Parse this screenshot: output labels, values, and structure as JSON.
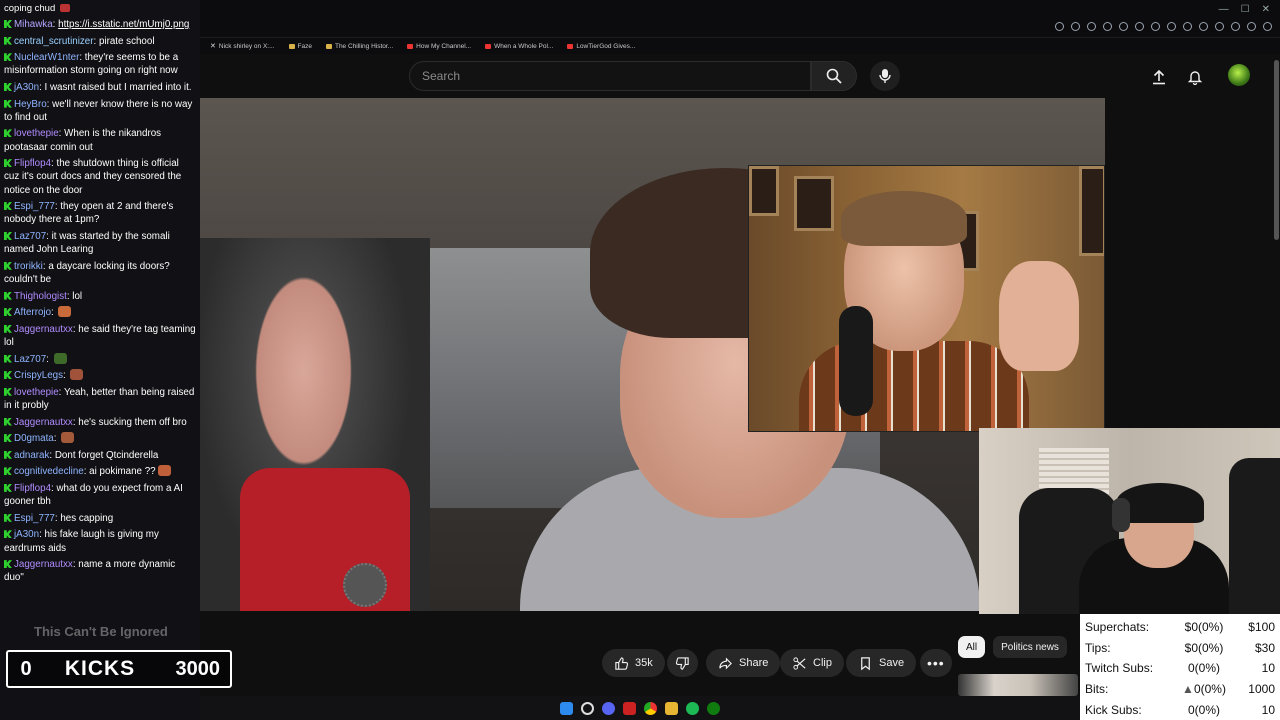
{
  "browser": {
    "bookmarks": [
      "Nick shirley on X:...",
      "Faze",
      "The Chilling Histor...",
      "How My Channel...",
      "When a Whole Pol...",
      "LowTierGod Gives..."
    ]
  },
  "youtube": {
    "search_placeholder": "Search",
    "actions": {
      "likes": "35k",
      "share": "Share",
      "clip": "Clip",
      "save": "Save"
    },
    "chips": [
      "All",
      "Politics news"
    ]
  },
  "chat": {
    "header_text": "coping chud",
    "messages": [
      {
        "user": "Mihawka",
        "text": "https://i.sstatic.net/mUmj0.png",
        "link": true,
        "color": "#b3a6ff"
      },
      {
        "user": "central_scrutinizer",
        "text": "pirate school",
        "color": "#9ad0ff"
      },
      {
        "user": "NuclearW1nter",
        "text": "they're seems to be a misinformation storm going on right now",
        "color": "#8fb4ff"
      },
      {
        "user": "jA30n",
        "text": "I wasnt raised but I married into it.",
        "color": "#8fb4ff"
      },
      {
        "user": "HeyBro",
        "text": "we'll never know there is no way to find out",
        "color": "#8fb4ff"
      },
      {
        "user": "lovethepie",
        "text": "When is the nikandros pootasaar comin out",
        "color": "#b18cff"
      },
      {
        "user": "Flipflop4",
        "text": "the shutdown thing is official cuz it's court docs and they censored the notice on the door",
        "color": "#b18cff"
      },
      {
        "user": "Espi_777",
        "text": "they open at 2 and there's nobody there at 1pm?",
        "color": "#8fb4ff"
      },
      {
        "user": "Laz707",
        "text": "it was started by the somali named John Learing",
        "color": "#8fb4ff"
      },
      {
        "user": "trorikki",
        "text": "a daycare locking its doors? couldn't be",
        "color": "#8fb4ff"
      },
      {
        "user": "Thighologist",
        "text": "lol",
        "color": "#b18cff"
      },
      {
        "user": "Afterrojo",
        "text": "",
        "emote": "#c96a3a",
        "color": "#8fb4ff"
      },
      {
        "user": "Jaggernautxx",
        "text": "he said they're tag teaming lol",
        "color": "#b18cff"
      },
      {
        "user": "Laz707",
        "text": "",
        "emote": "#3f6b2a",
        "color": "#8fb4ff"
      },
      {
        "user": "CrispyLegs",
        "text": "",
        "emote": "#a0523b",
        "color": "#8fb4ff"
      },
      {
        "user": "lovethepie",
        "text": "Yeah, better than being raised in it probly",
        "color": "#b18cff"
      },
      {
        "user": "Jaggernautxx",
        "text": "he's sucking them off bro",
        "color": "#b18cff"
      },
      {
        "user": "D0gmata",
        "text": "",
        "emote": "#a35a3a",
        "color": "#8fb4ff"
      },
      {
        "user": "adnarak",
        "text": "Dont forget Qtcinderella",
        "color": "#8fb4ff"
      },
      {
        "user": "cognitivedecline",
        "text": "ai pokimane ??",
        "emote": "#c0603a",
        "color": "#8fb4ff"
      },
      {
        "user": "Flipflop4",
        "text": "what do you expect from a AI gooner tbh",
        "color": "#b18cff"
      },
      {
        "user": "Espi_777",
        "text": "hes capping",
        "color": "#8fb4ff"
      },
      {
        "user": "jA30n",
        "text": "his fake laugh is giving my eardrums aids",
        "color": "#8fb4ff"
      },
      {
        "user": "Jaggernautxx",
        "text": "name a more dynamic duo\"",
        "color": "#b18cff"
      }
    ],
    "notice": "This Can't Be Ignored",
    "kicks": {
      "current": "0",
      "label": "KICKS",
      "goal": "3000"
    }
  },
  "stats": [
    {
      "label": "Superchats:",
      "value": "$0(0%)",
      "goal": "$100"
    },
    {
      "label": "Tips:",
      "value": "$0(0%)",
      "goal": "$30"
    },
    {
      "label": "Twitch Subs:",
      "value": "0(0%)",
      "goal": "10"
    },
    {
      "label": "Bits:",
      "value": "0(0%)",
      "goal": "1000",
      "warn": true
    },
    {
      "label": "Kick Subs:",
      "value": "0(0%)",
      "goal": "10"
    }
  ],
  "colors": {
    "like_pill": "#272727",
    "kick_green": "#2fd12f",
    "brand_red": "#e33"
  }
}
